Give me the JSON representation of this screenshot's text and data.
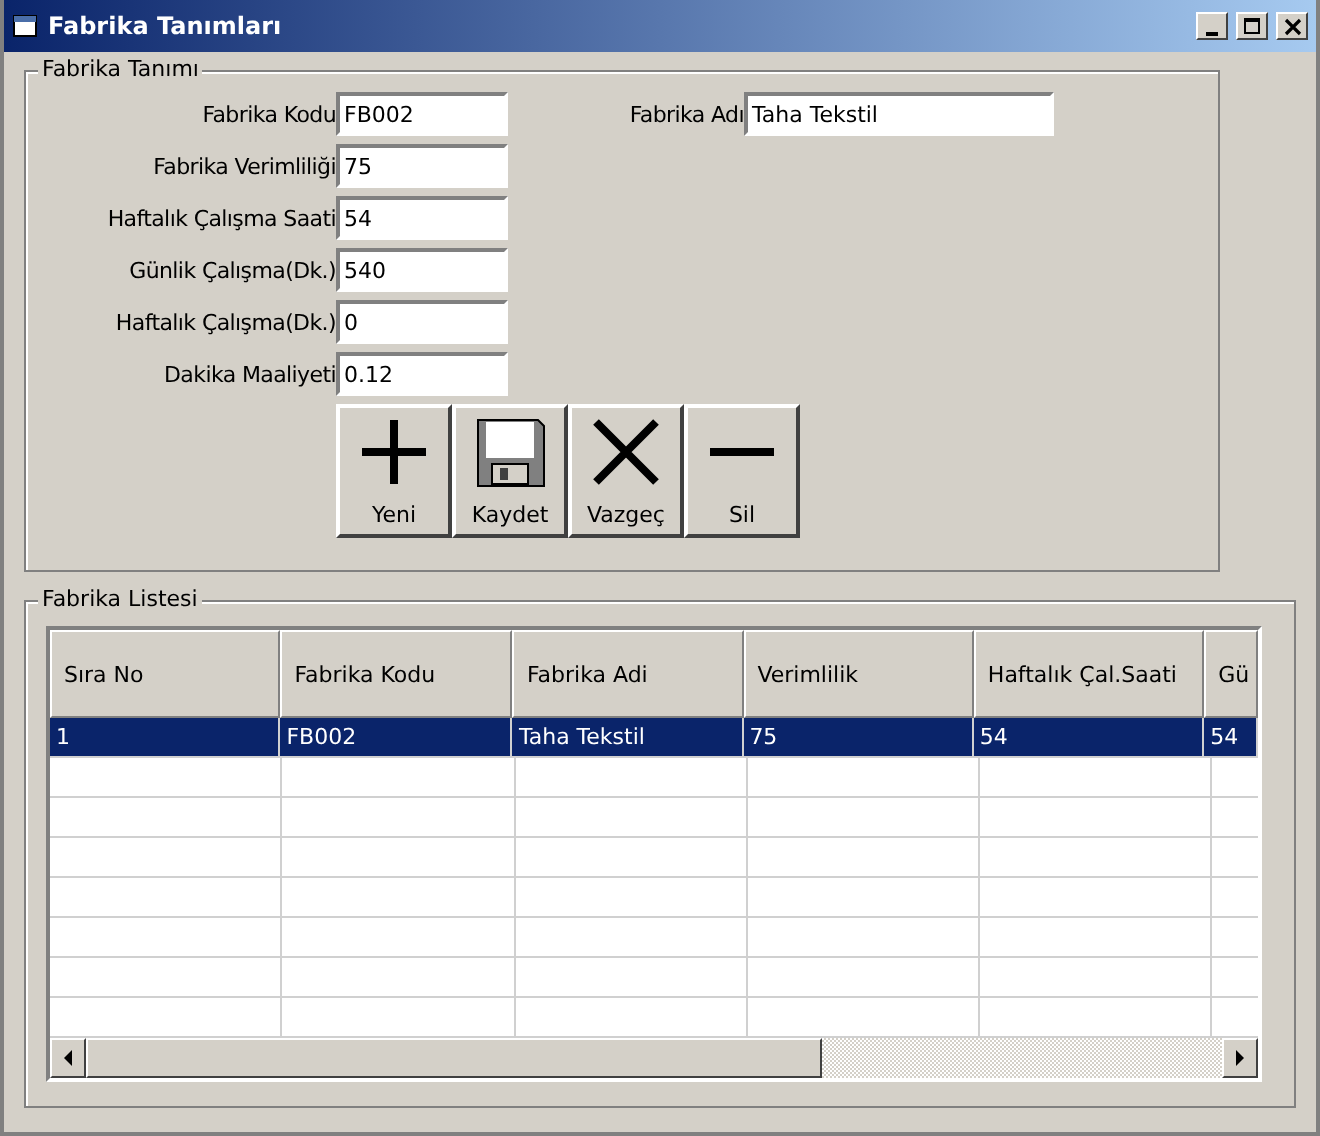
{
  "window": {
    "title": "Fabrika Tanımları"
  },
  "form": {
    "title": "Fabrika Tanımı",
    "fields": [
      {
        "label": "Fabrika Kodu",
        "value": "FB002"
      },
      {
        "label": "Fabrika Verimliliği",
        "value": "75"
      },
      {
        "label": "Haftalık Çalışma Saati",
        "value": "54"
      },
      {
        "label": "Günlik Çalışma(Dk.)",
        "value": "540"
      },
      {
        "label": "Haftalık Çalışma(Dk.)",
        "value": "0"
      },
      {
        "label": "Dakika Maaliyeti",
        "value": "0.12"
      }
    ],
    "side_field": {
      "label": "Fabrika Adı",
      "value": "Taha Tekstil"
    },
    "buttons": [
      {
        "kind": "plus",
        "label": "Yeni"
      },
      {
        "kind": "save",
        "label": "Kaydet"
      },
      {
        "kind": "cross",
        "label": "Vazgeç"
      },
      {
        "kind": "minus",
        "label": "Sil"
      }
    ]
  },
  "list": {
    "title": "Fabrika Listesi",
    "columns": [
      "Sıra No",
      "Fabrika Kodu",
      "Fabrika Adi",
      "Verimlilik",
      "Haftalık Çal.Saati",
      "Gü"
    ],
    "rows": [
      {
        "selected": true,
        "cells": [
          "1",
          "FB002",
          "Taha Tekstil",
          "75",
          "54",
          "54"
        ]
      }
    ]
  }
}
